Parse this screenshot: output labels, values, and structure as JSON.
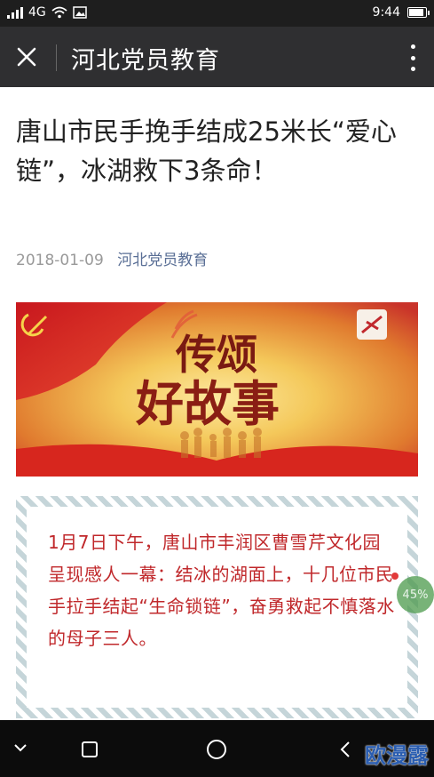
{
  "status_bar": {
    "network": "4G",
    "time": "9:44",
    "battery_level": 0.9,
    "icons": [
      "signal-icon",
      "wifi-icon",
      "image-notification-icon",
      "battery-icon"
    ]
  },
  "header": {
    "title": "河北党员教育",
    "icons": [
      "close-icon",
      "more-options-icon"
    ]
  },
  "article": {
    "title": "唐山市民手挽手结成25米长“爱心链”，冰湖救下3条命！",
    "date": "2018-01-09",
    "source": "河北党员教育"
  },
  "banner": {
    "line1": "传颂",
    "line2": "好故事"
  },
  "quote": {
    "text": "1月7日下午，唐山市丰润区曹雪芹文化园呈现感人一幕：结冰的湖面上，十几位市民手拉手结起“生命锁链”，奋勇救起不慎落水的母子三人。"
  },
  "progress_badge": {
    "label": "45%",
    "value": 45
  },
  "watermark": "欧漫露",
  "colors": {
    "status_bar": "#1e1e1e",
    "title_bar": "#2f2f31",
    "quote_text": "#c0282b",
    "source_link": "#5a6f96",
    "banner_red": "#d0322a",
    "banner_gold": "#f4c85a"
  }
}
